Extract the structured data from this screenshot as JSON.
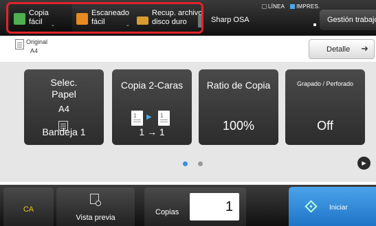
{
  "shortcuts": [
    {
      "line1": "Copia",
      "line2": "fácil",
      "icon": "copy-icon",
      "color": "#4caf50"
    },
    {
      "line1": "Escaneado",
      "line2": "fácil",
      "icon": "scan-icon",
      "color": "#e98a20"
    },
    {
      "line1": "Recup. archivo",
      "line2": "disco duro",
      "icon": "folder-icon",
      "color": "#d99b30"
    }
  ],
  "header": {
    "device_name": "Sharp OSA",
    "status_line": "LÍNEA",
    "status_print": "IMPRES.",
    "job_status": "Gestión trabajo"
  },
  "original": {
    "label": "Original",
    "size": "A4"
  },
  "detail_button": "Detalle",
  "tiles": {
    "paper": {
      "title_line1": "Selec.",
      "title_line2": "Papel",
      "size": "A4",
      "value": "Bandeja 1"
    },
    "duplex": {
      "title": "Copia 2-Caras",
      "page1": "1",
      "page2": "1",
      "value": "1 → 1"
    },
    "ratio": {
      "title": "Ratio de Copia",
      "value": "100%"
    },
    "staple": {
      "title": "Grapado / Perforado",
      "value": "Off"
    }
  },
  "pager": {
    "pages": 2,
    "current": 1
  },
  "bottom": {
    "ca_label": "CA",
    "preview_label": "Vista previa",
    "copies_label": "Copias",
    "copies_value": "1",
    "start_label": "Iniciar"
  },
  "colors": {
    "highlight": "#e4222b",
    "accent": "#3a8ee6",
    "start": "#2f86d8",
    "ca_text": "#f0c419"
  }
}
